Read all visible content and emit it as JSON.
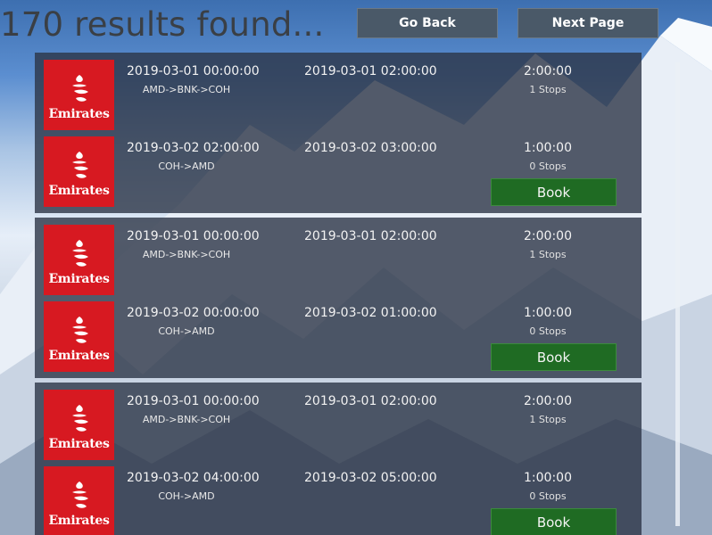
{
  "header": {
    "results_text": "170 results found...",
    "go_back_label": "Go Back",
    "next_page_label": "Next Page"
  },
  "airline_logo_text": "Emirates",
  "book_label": "Book",
  "results": [
    {
      "outbound": {
        "departure": "2019-03-01 00:00:00",
        "arrival": "2019-03-01 02:00:00",
        "route": "AMD->BNK->COH",
        "duration": "2:00:00",
        "stops": "1 Stops"
      },
      "return": {
        "departure": "2019-03-02 02:00:00",
        "arrival": "2019-03-02 03:00:00",
        "route": "COH->AMD",
        "duration": "1:00:00",
        "stops": "0 Stops"
      }
    },
    {
      "outbound": {
        "departure": "2019-03-01 00:00:00",
        "arrival": "2019-03-01 02:00:00",
        "route": "AMD->BNK->COH",
        "duration": "2:00:00",
        "stops": "1 Stops"
      },
      "return": {
        "departure": "2019-03-02 00:00:00",
        "arrival": "2019-03-02 01:00:00",
        "route": "COH->AMD",
        "duration": "1:00:00",
        "stops": "0 Stops"
      }
    },
    {
      "outbound": {
        "departure": "2019-03-01 00:00:00",
        "arrival": "2019-03-01 02:00:00",
        "route": "AMD->BNK->COH",
        "duration": "2:00:00",
        "stops": "1 Stops"
      },
      "return": {
        "departure": "2019-03-02 04:00:00",
        "arrival": "2019-03-02 05:00:00",
        "route": "COH->AMD",
        "duration": "1:00:00",
        "stops": "0 Stops"
      }
    }
  ],
  "colors": {
    "logo_red": "#d71921",
    "book_green": "#1f6b23",
    "nav_button": "#4a5968"
  }
}
